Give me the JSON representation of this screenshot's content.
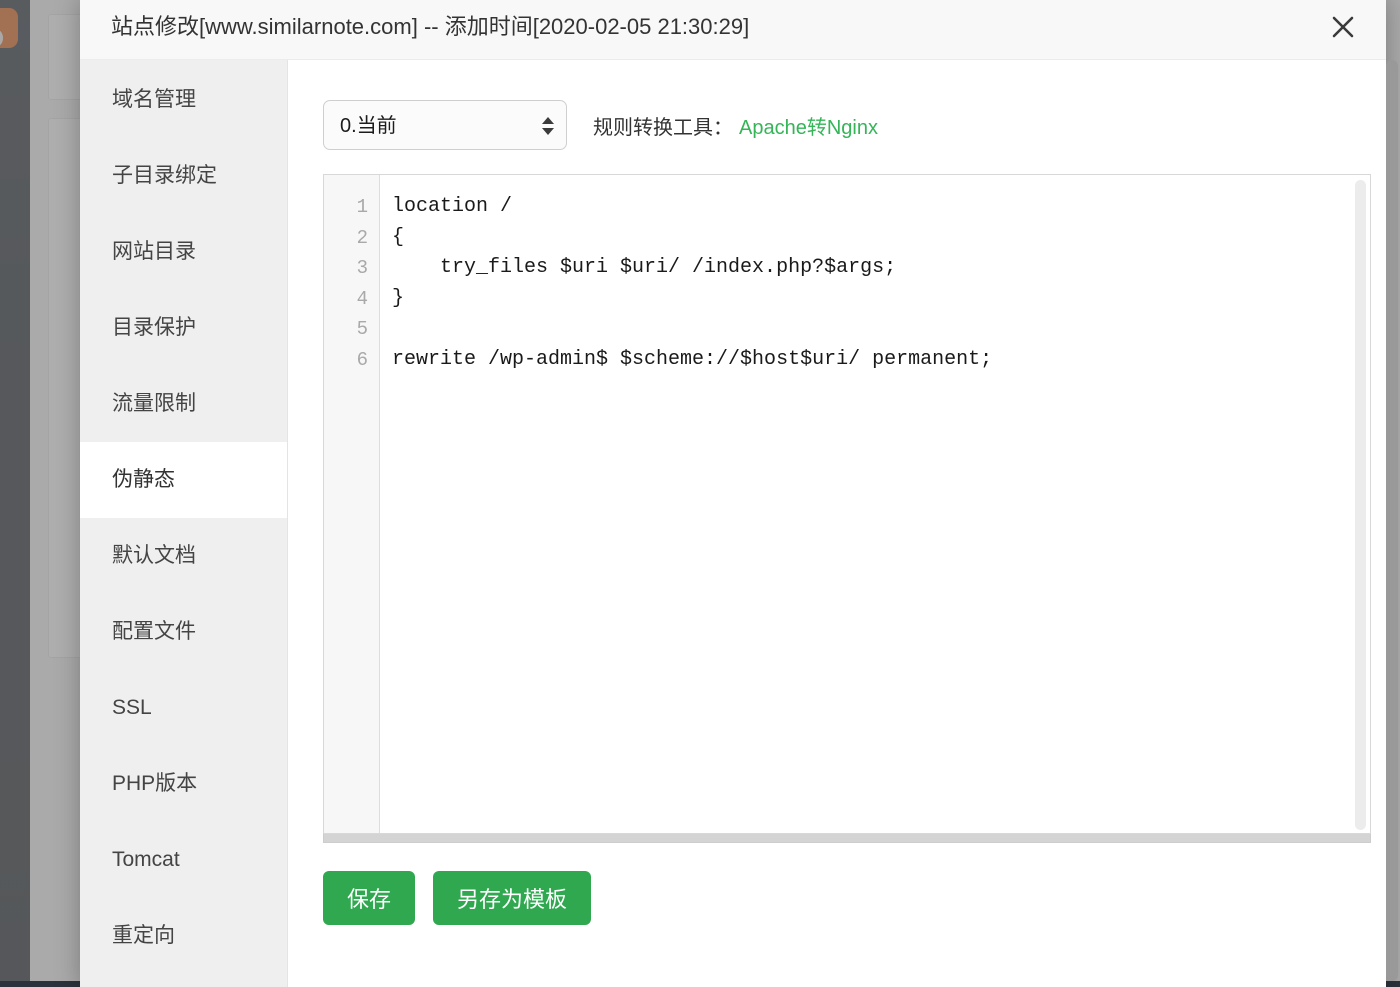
{
  "modal": {
    "title": "站点修改[www.similarnote.com] -- 添加时间[2020-02-05 21:30:29]",
    "close_icon": "close-icon"
  },
  "sidebar": {
    "items": [
      {
        "label": "域名管理",
        "active": false
      },
      {
        "label": "子目录绑定",
        "active": false
      },
      {
        "label": "网站目录",
        "active": false
      },
      {
        "label": "目录保护",
        "active": false
      },
      {
        "label": "流量限制",
        "active": false
      },
      {
        "label": "伪静态",
        "active": true
      },
      {
        "label": "默认文档",
        "active": false
      },
      {
        "label": "配置文件",
        "active": false
      },
      {
        "label": "SSL",
        "active": false
      },
      {
        "label": "PHP版本",
        "active": false
      },
      {
        "label": "Tomcat",
        "active": false
      },
      {
        "label": "重定向",
        "active": false
      }
    ]
  },
  "toolbar": {
    "select_value": "0.当前",
    "select_options": [
      "0.当前"
    ],
    "tool_label": "规则转换工具：",
    "tool_link": "Apache转Nginx",
    "link_color": "#35b558"
  },
  "editor": {
    "line_numbers": [
      "1",
      "2",
      "3",
      "4",
      "5",
      "6"
    ],
    "lines": [
      "location /",
      "{",
      "    try_files $uri $uri/ /index.php?$args;",
      "}",
      "",
      "rewrite /wp-admin$ $scheme://$host$uri/ permanent;"
    ]
  },
  "actions": {
    "save_label": "保存",
    "save_as_template_label": "另存为模板",
    "button_color": "#2fa84f"
  }
}
